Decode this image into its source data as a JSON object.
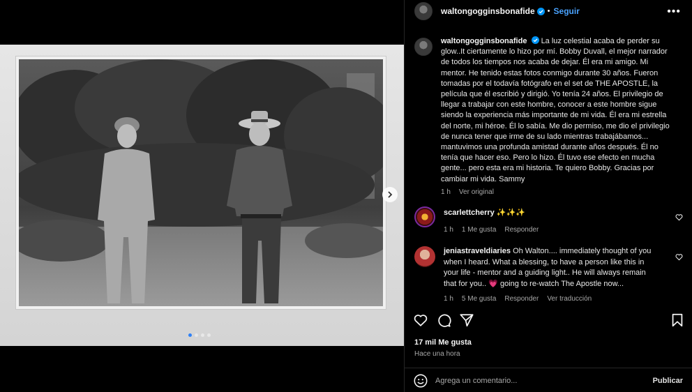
{
  "colors": {
    "accent": "#4aa3ff",
    "verified": "#0095f6",
    "like_heart": "#ff3040"
  },
  "post": {
    "username": "waltongogginsbonafide",
    "follow_label": "Seguir",
    "more_icon": "more-horizontal-icon",
    "caption_text": "La luz celestial acaba de perder su glow..It ciertamente lo hizo por mí. Bobby Duvall, el mejor narrador de todos los tiempos nos acaba de dejar. Él era mi amigo. Mi mentor. He tenido estas fotos conmigo durante 30 años. Fueron tomadas por el todavía fotógrafo en el set de THE APOSTLE, la película que él escribió y dirigió. Yo tenía 24 años. El privilegio de llegar a trabajar con este hombre, conocer a este hombre sigue siendo la experiencia más importante de mi vida. Él era mi estrella del norte, mi héroe. Él lo sabía. Me dio permiso, me dio el privilegio de nunca tener que irme de su lado mientras trabajábamos... mantuvimos una profunda amistad durante años después. Él no tenía que hacer eso. Pero lo hizo. Él tuvo ese efecto en mucha gente... pero esta era mi historia. Te quiero Bobby. Gracias por cambiar mi vida. Sammy",
    "caption_time": "1 h",
    "caption_see_original": "Ver original",
    "likes": "17 mil Me gusta",
    "posted_ago": "Hace una hora",
    "carousel": {
      "count": 4,
      "active_index": 0
    }
  },
  "comments": [
    {
      "username": "scarlettcherry",
      "text": "✨✨✨",
      "time": "1 h",
      "likes": "1 Me gusta",
      "reply": "Responder"
    },
    {
      "username": "jeniastraveldiaries",
      "text": "Oh Walton.... immediately thought of you when I heard. What a blessing, to have a person like this in your life - mentor and a guiding light.. He will always remain that for you.. 💗 going to re-watch The Apostle now...",
      "time": "1 h",
      "likes": "5 Me gusta",
      "reply": "Responder",
      "translate": "Ver traducción"
    }
  ],
  "composer": {
    "placeholder": "Agrega un comentario...",
    "publish_label": "Publicar"
  }
}
